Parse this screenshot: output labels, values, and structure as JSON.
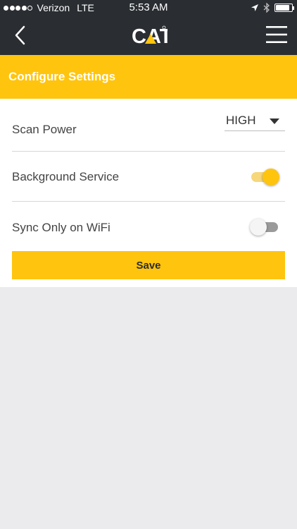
{
  "status_bar": {
    "carrier": "Verizon",
    "network": "LTE",
    "time": "5:53 AM",
    "signal_dots_filled": 4,
    "signal_dots_total": 5,
    "battery_level": 0.85
  },
  "nav": {
    "logo_text": "CAT",
    "back_icon": "chevron-left-icon",
    "menu_icon": "hamburger-menu-icon"
  },
  "header": {
    "title": "Configure Settings"
  },
  "settings": {
    "scan_power": {
      "label": "Scan Power",
      "value": "HIGH"
    },
    "background_service": {
      "label": "Background Service",
      "enabled": true
    },
    "sync_wifi": {
      "label": "Sync Only on WiFi",
      "enabled": false
    }
  },
  "save_label": "Save",
  "colors": {
    "accent": "#ffc40e",
    "nav_bg": "#2a2d32",
    "page_bg": "#ebebee"
  }
}
